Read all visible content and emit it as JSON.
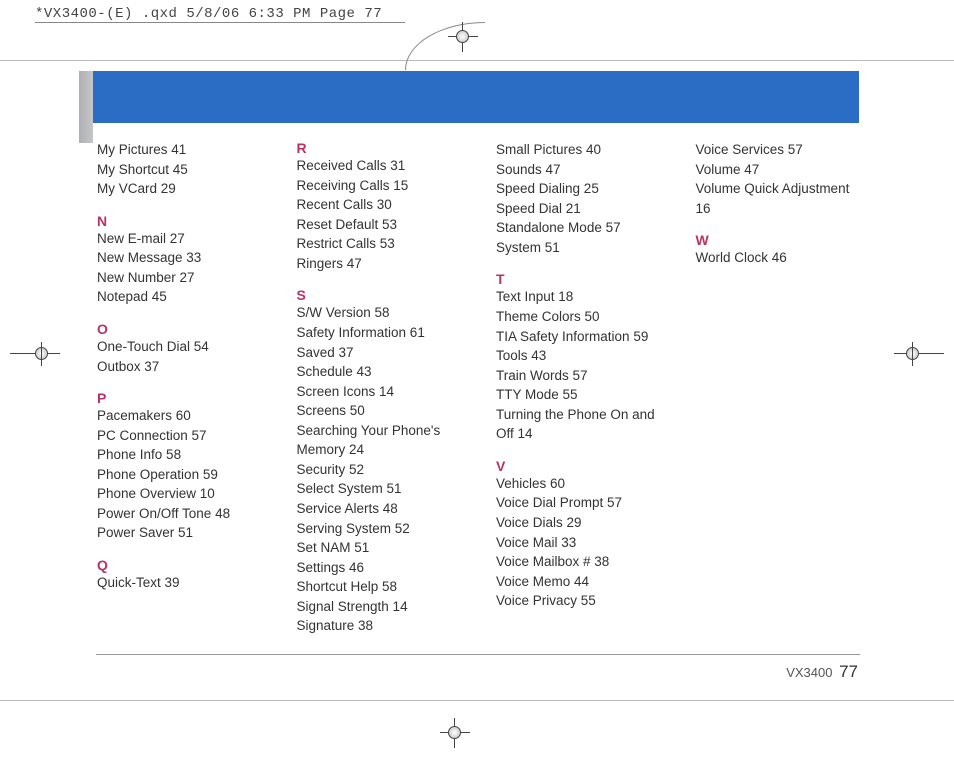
{
  "header_annotation": "*VX3400-(E) .qxd  5/8/06  6:33 PM  Page 77",
  "footer_model": "VX3400",
  "footer_page": "77",
  "columns": [
    [
      {
        "entries": [
          "My Pictures  41",
          "My Shortcut  45",
          "My VCard  29"
        ]
      },
      {
        "letter": "N",
        "entries": [
          "New E-mail  27",
          "New Message  33",
          "New Number 27",
          "Notepad  45"
        ]
      },
      {
        "letter": "O",
        "entries": [
          "One-Touch Dial  54",
          "Outbox  37"
        ]
      },
      {
        "letter": "P",
        "entries": [
          "Pacemakers  60",
          "PC Connection  57",
          "Phone Info  58",
          "Phone Operation  59",
          "Phone Overview  10",
          "Power On/Off Tone  48",
          "Power Saver  51"
        ]
      },
      {
        "letter": "Q",
        "entries": [
          "Quick-Text  39"
        ]
      }
    ],
    [
      {
        "letter": "R",
        "entries": [
          "Received Calls  31",
          "Receiving Calls  15",
          "Recent Calls  30",
          "Reset Default  53",
          "Restrict Calls  53",
          "Ringers  47"
        ]
      },
      {
        "letter": "S",
        "entries": [
          "S/W Version  58",
          "Safety Information  61",
          "Saved  37",
          "Schedule  43",
          "Screen Icons  14",
          "Screens  50",
          "Searching Your Phone's Memory  24",
          "Security  52",
          "Select System  51",
          "Service Alerts  48",
          "Serving System  52",
          "Set NAM  51",
          "Settings  46",
          "Shortcut Help  58",
          "Signal Strength  14",
          "Signature  38"
        ]
      }
    ],
    [
      {
        "entries": [
          "Small Pictures  40",
          "Sounds  47",
          "Speed Dialing  25",
          "Speed Dial  21",
          "Standalone Mode 57",
          "System  51"
        ]
      },
      {
        "letter": "T",
        "entries": [
          "Text Input  18",
          "Theme Colors  50",
          "TIA Safety Information  59",
          "Tools  43",
          "Train Words  57",
          "TTY Mode  55",
          "Turning the Phone On and Off  14"
        ]
      },
      {
        "letter": "V",
        "entries": [
          "Vehicles  60",
          "Voice Dial Prompt  57",
          "Voice Dials  29",
          "Voice Mail  33",
          "Voice Mailbox #  38",
          "Voice Memo  44",
          "Voice Privacy  55"
        ]
      }
    ],
    [
      {
        "entries": [
          "Voice Services  57",
          "Volume  47",
          "Volume Quick Adjustment  16"
        ]
      },
      {
        "letter": "W",
        "entries": [
          "World Clock  46"
        ]
      }
    ]
  ]
}
